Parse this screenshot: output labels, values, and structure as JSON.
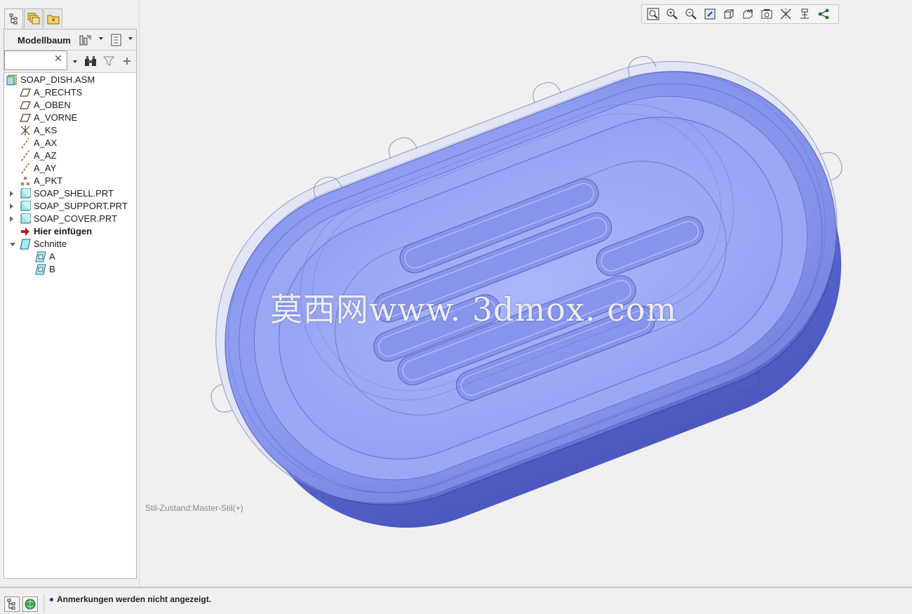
{
  "left_panel": {
    "tabs": [
      {
        "name": "model-tree-tab-icon"
      },
      {
        "name": "layers-tab-icon"
      },
      {
        "name": "folder-browser-tab-icon"
      }
    ],
    "tree_title": "Modellbaum",
    "search": {
      "value": "",
      "placeholder": ""
    },
    "tree": [
      {
        "label": "SOAP_DISH.ASM",
        "icon": "assembly-icon",
        "level": 0,
        "expander": "none"
      },
      {
        "label": "A_RECHTS",
        "icon": "datum-plane-icon",
        "level": 1,
        "expander": "none"
      },
      {
        "label": "A_OBEN",
        "icon": "datum-plane-icon",
        "level": 1,
        "expander": "none"
      },
      {
        "label": "A_VORNE",
        "icon": "datum-plane-icon",
        "level": 1,
        "expander": "none"
      },
      {
        "label": "A_KS",
        "icon": "coordinate-system-icon",
        "level": 1,
        "expander": "none"
      },
      {
        "label": "A_AX",
        "icon": "datum-axis-icon",
        "level": 1,
        "expander": "none"
      },
      {
        "label": "A_AZ",
        "icon": "datum-axis-icon",
        "level": 1,
        "expander": "none"
      },
      {
        "label": "A_AY",
        "icon": "datum-axis-icon",
        "level": 1,
        "expander": "none"
      },
      {
        "label": "A_PKT",
        "icon": "datum-point-icon",
        "level": 1,
        "expander": "none"
      },
      {
        "label": "SOAP_SHELL.PRT",
        "icon": "part-icon",
        "level": 1,
        "expander": "collapsed"
      },
      {
        "label": "SOAP_SUPPORT.PRT",
        "icon": "part-icon",
        "level": 1,
        "expander": "collapsed"
      },
      {
        "label": "SOAP_COVER.PRT",
        "icon": "part-icon",
        "level": 1,
        "expander": "collapsed"
      },
      {
        "label": "Hier einfügen",
        "icon": "insert-here-arrow-icon",
        "level": 1,
        "expander": "none",
        "bold": true
      },
      {
        "label": "Schnitte",
        "icon": "section-folder-icon",
        "level": 1,
        "expander": "expanded"
      },
      {
        "label": "A",
        "icon": "section-icon",
        "level": 2,
        "expander": "none"
      },
      {
        "label": "B",
        "icon": "section-icon",
        "level": 2,
        "expander": "none"
      }
    ]
  },
  "view_toolbar": [
    "refit-icon",
    "zoom-in-icon",
    "zoom-out-icon",
    "repaint-icon",
    "display-style-icon",
    "saved-orientations-icon",
    "view-manager-icon",
    "datum-display-icon",
    "annotation-display-icon",
    "spin-center-icon"
  ],
  "graphics": {
    "style_state": "Stil-Zustand:Master-Stil(+)",
    "watermark": "莫西网www. 3dmox. com",
    "model_color": "#7f8ff0",
    "background_color": "#f0f0f0"
  },
  "status_bar": {
    "message": "Anmerkungen werden nicht angezeigt."
  }
}
